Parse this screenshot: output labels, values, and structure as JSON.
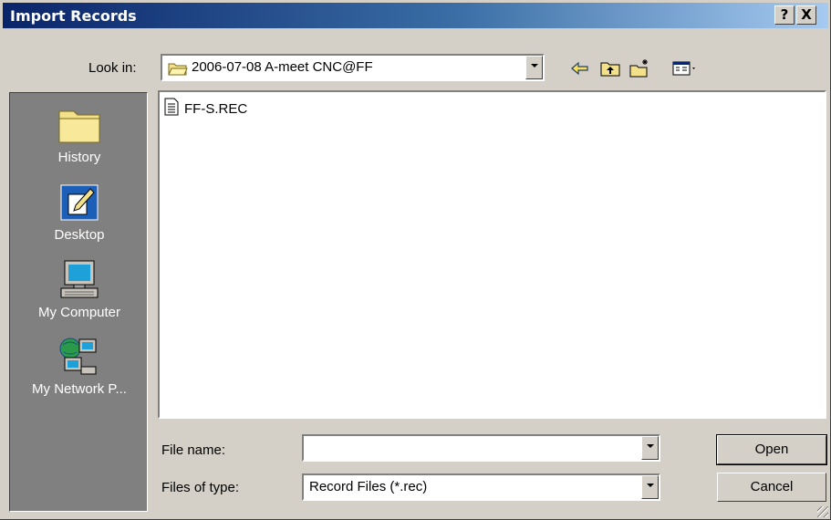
{
  "window": {
    "title": "Import Records",
    "help_button": "?",
    "close_button": "X"
  },
  "toolbar": {
    "look_in_label": "Look in:",
    "look_in_value": "2006-07-08 A-meet CNC@FF",
    "icons": [
      "back-icon",
      "up-folder-icon",
      "new-folder-icon",
      "view-menu-icon"
    ]
  },
  "places": [
    {
      "label": "History",
      "icon": "history-folder-icon"
    },
    {
      "label": "Desktop",
      "icon": "desktop-icon"
    },
    {
      "label": "My Computer",
      "icon": "my-computer-icon"
    },
    {
      "label": "My Network P...",
      "icon": "network-places-icon"
    }
  ],
  "files": [
    {
      "name": "FF-S.REC",
      "icon": "text-file-icon"
    }
  ],
  "form": {
    "file_name_label": "File name:",
    "file_name_value": "",
    "file_type_label": "Files of type:",
    "file_type_value": "Record Files (*.rec)"
  },
  "buttons": {
    "open": "Open",
    "cancel": "Cancel"
  },
  "colors": {
    "title_start": "#0a246a",
    "title_end": "#a6caf0",
    "face": "#d4d0c8",
    "places_bg": "#808080"
  }
}
